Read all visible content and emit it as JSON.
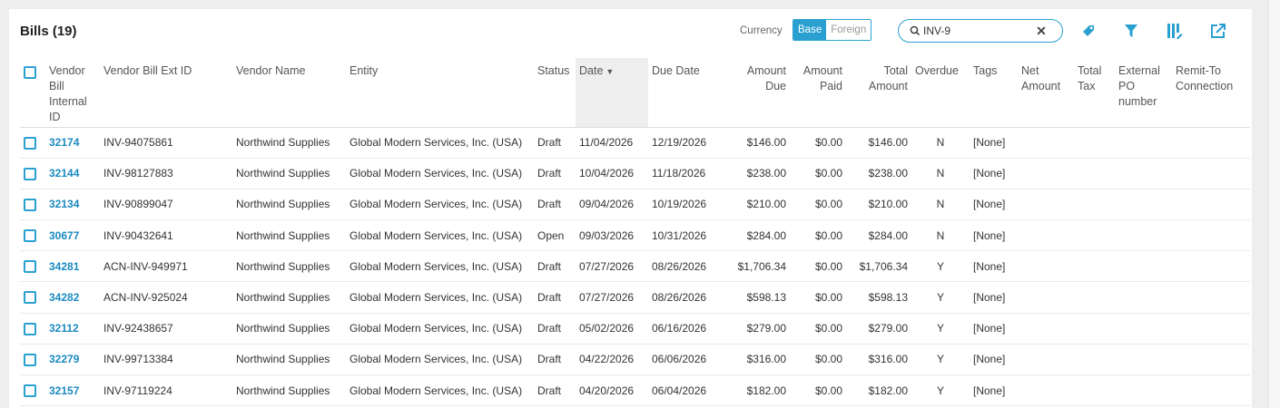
{
  "header": {
    "title": "Bills (19)"
  },
  "currency": {
    "label": "Currency",
    "options": [
      "Base",
      "Foreign"
    ],
    "selected": "Base"
  },
  "search": {
    "value": "INV-9"
  },
  "toolbar": {
    "icons": [
      "tag-icon",
      "filter-icon",
      "columns-icon",
      "export-icon"
    ]
  },
  "colors": {
    "accent": "#2aa0d0",
    "link": "#1a8ac0"
  },
  "columns": [
    "Vendor Bill Internal ID",
    "Vendor Bill Ext ID",
    "Vendor Name",
    "Entity",
    "Status",
    "Date",
    "Due Date",
    "Amount Due",
    "Amount Paid",
    "Total Amount",
    "Overdue",
    "Tags",
    "Net Amount",
    "Total Tax",
    "External PO number",
    "Remit-To Connection"
  ],
  "sort": {
    "column": "Date",
    "direction": "desc"
  },
  "rows": [
    {
      "internal_id": "32174",
      "ext_id": "INV-94075861",
      "vendor": "Northwind Supplies",
      "entity": "Global Modern Services, Inc. (USA)",
      "status": "Draft",
      "date": "11/04/2026",
      "due": "12/19/2026",
      "amount_due": "$146.00",
      "amount_paid": "$0.00",
      "total": "$146.00",
      "overdue": "N",
      "tags": "[None]"
    },
    {
      "internal_id": "32144",
      "ext_id": "INV-98127883",
      "vendor": "Northwind Supplies",
      "entity": "Global Modern Services, Inc. (USA)",
      "status": "Draft",
      "date": "10/04/2026",
      "due": "11/18/2026",
      "amount_due": "$238.00",
      "amount_paid": "$0.00",
      "total": "$238.00",
      "overdue": "N",
      "tags": "[None]"
    },
    {
      "internal_id": "32134",
      "ext_id": "INV-90899047",
      "vendor": "Northwind Supplies",
      "entity": "Global Modern Services, Inc. (USA)",
      "status": "Draft",
      "date": "09/04/2026",
      "due": "10/19/2026",
      "amount_due": "$210.00",
      "amount_paid": "$0.00",
      "total": "$210.00",
      "overdue": "N",
      "tags": "[None]"
    },
    {
      "internal_id": "30677",
      "ext_id": "INV-90432641",
      "vendor": "Northwind Supplies",
      "entity": "Global Modern Services, Inc. (USA)",
      "status": "Open",
      "date": "09/03/2026",
      "due": "10/31/2026",
      "amount_due": "$284.00",
      "amount_paid": "$0.00",
      "total": "$284.00",
      "overdue": "N",
      "tags": "[None]"
    },
    {
      "internal_id": "34281",
      "ext_id": "ACN-INV-949971",
      "vendor": "Northwind Supplies",
      "entity": "Global Modern Services, Inc. (USA)",
      "status": "Draft",
      "date": "07/27/2026",
      "due": "08/26/2026",
      "amount_due": "$1,706.34",
      "amount_paid": "$0.00",
      "total": "$1,706.34",
      "overdue": "Y",
      "tags": "[None]"
    },
    {
      "internal_id": "34282",
      "ext_id": "ACN-INV-925024",
      "vendor": "Northwind Supplies",
      "entity": "Global Modern Services, Inc. (USA)",
      "status": "Draft",
      "date": "07/27/2026",
      "due": "08/26/2026",
      "amount_due": "$598.13",
      "amount_paid": "$0.00",
      "total": "$598.13",
      "overdue": "Y",
      "tags": "[None]"
    },
    {
      "internal_id": "32112",
      "ext_id": "INV-92438657",
      "vendor": "Northwind Supplies",
      "entity": "Global Modern Services, Inc. (USA)",
      "status": "Draft",
      "date": "05/02/2026",
      "due": "06/16/2026",
      "amount_due": "$279.00",
      "amount_paid": "$0.00",
      "total": "$279.00",
      "overdue": "Y",
      "tags": "[None]"
    },
    {
      "internal_id": "32279",
      "ext_id": "INV-99713384",
      "vendor": "Northwind Supplies",
      "entity": "Global Modern Services, Inc. (USA)",
      "status": "Draft",
      "date": "04/22/2026",
      "due": "06/06/2026",
      "amount_due": "$316.00",
      "amount_paid": "$0.00",
      "total": "$316.00",
      "overdue": "Y",
      "tags": "[None]"
    },
    {
      "internal_id": "32157",
      "ext_id": "INV-97119224",
      "vendor": "Northwind Supplies",
      "entity": "Global Modern Services, Inc. (USA)",
      "status": "Draft",
      "date": "04/20/2026",
      "due": "06/04/2026",
      "amount_due": "$182.00",
      "amount_paid": "$0.00",
      "total": "$182.00",
      "overdue": "Y",
      "tags": "[None]"
    }
  ]
}
